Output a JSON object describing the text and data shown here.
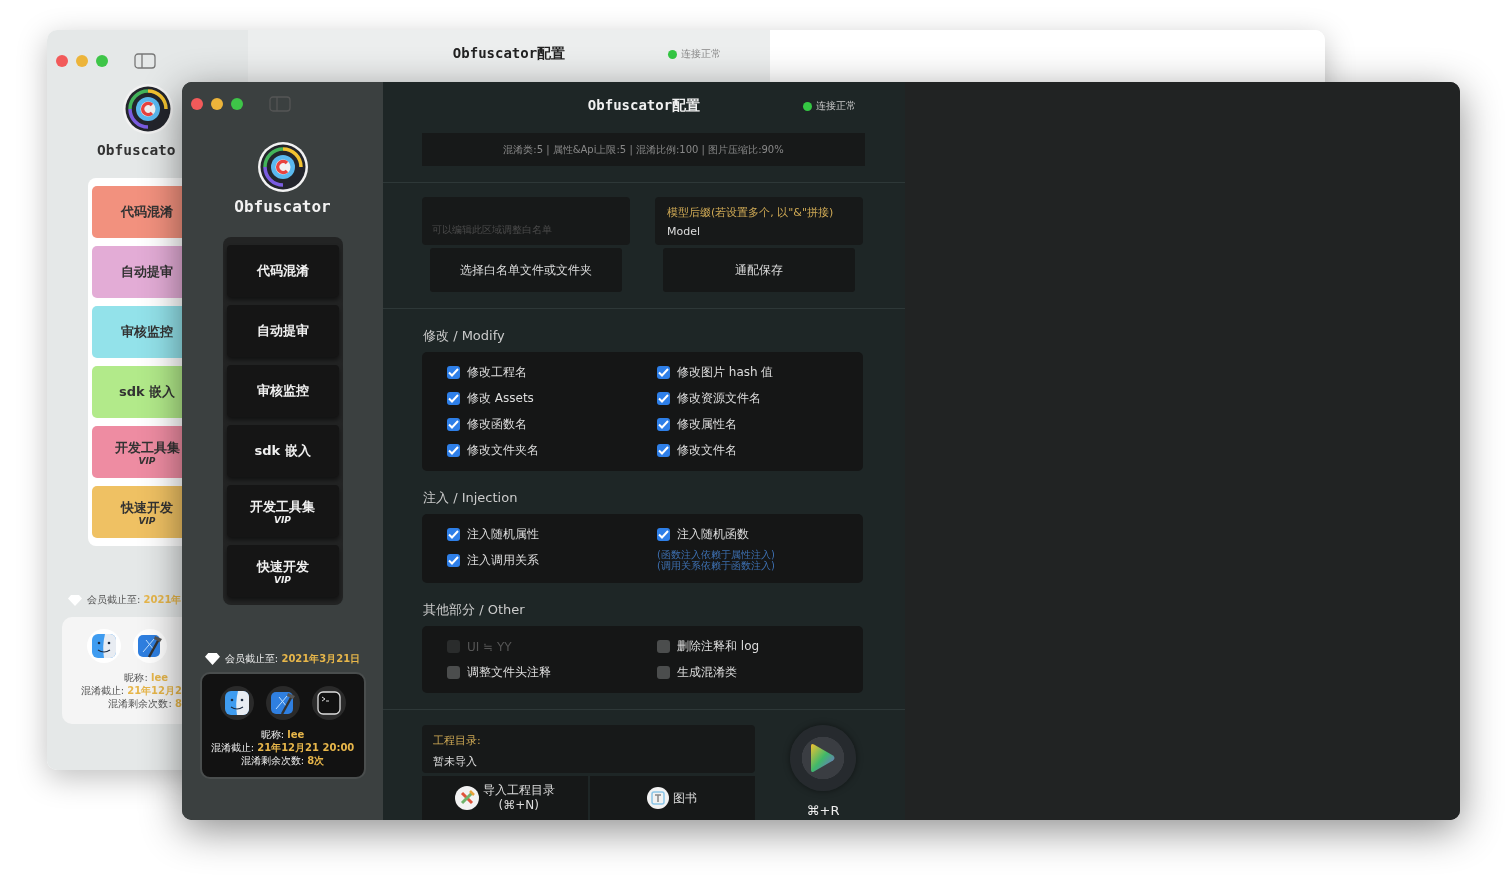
{
  "back_window": {
    "title": "Obfuscator配置",
    "status": "连接正常",
    "app_name": "Obfuscato",
    "nav_items": [
      {
        "label": "代码混淆",
        "color": "#f2917e"
      },
      {
        "label": "自动提审",
        "color": "#e3acd6"
      },
      {
        "label": "审核监控",
        "color": "#93e2ea"
      },
      {
        "label": "sdk 嵌入",
        "color": "#b2ea8a"
      },
      {
        "label": "开发工具集",
        "badge": "VIP",
        "color": "#ee8ca2"
      },
      {
        "label": "快速开发",
        "badge": "VIP",
        "color": "#efc163"
      }
    ],
    "membership": {
      "label": "会员截止至:",
      "value": "2021年"
    },
    "user": {
      "nickname_label": "昵称:",
      "nickname": "lee",
      "expiry_label": "混淆截止:",
      "expiry": "21年12月2",
      "remaining_label": "混淆剩余次数:",
      "remaining": "8"
    }
  },
  "window": {
    "title": "Obfuscator配置",
    "status": "连接正常",
    "app_name": "Obfuscator",
    "nav_items": [
      {
        "label": "代码混淆"
      },
      {
        "label": "自动提审"
      },
      {
        "label": "审核监控"
      },
      {
        "label": "sdk 嵌入"
      },
      {
        "label": "开发工具集",
        "badge": "VIP"
      },
      {
        "label": "快速开发",
        "badge": "VIP"
      }
    ],
    "membership": {
      "label": "会员截止至:",
      "value": "2021年3月21日"
    },
    "user": {
      "nickname_label": "昵称:",
      "nickname": "lee",
      "expiry_label": "混淆截止:",
      "expiry": "21年12月21 20:00",
      "remaining_label": "混淆剩余次数:",
      "remaining": "8次"
    },
    "stats": "混淆类:5 | 属性&Api上限:5 | 混淆比例:100 | 图片压缩比:90%",
    "whitelist": {
      "placeholder": "可以编辑此区域调整白名单",
      "button": "选择白名单文件或文件夹"
    },
    "model_suffix": {
      "label": "模型后缀(若设置多个, 以\"&\"拼接)",
      "value": "Model",
      "button": "通配保存"
    },
    "sections": [
      {
        "title": "修改 / Modify",
        "items": [
          {
            "label": "修改工程名",
            "checked": true,
            "disabled": false
          },
          {
            "label": "修改图片 hash 值",
            "checked": true,
            "disabled": false
          },
          {
            "label": "修改 Assets",
            "checked": true,
            "disabled": false
          },
          {
            "label": "修改资源文件名",
            "checked": true,
            "disabled": false
          },
          {
            "label": "修改函数名",
            "checked": true,
            "disabled": false
          },
          {
            "label": "修改属性名",
            "checked": true,
            "disabled": false
          },
          {
            "label": "修改文件夹名",
            "checked": true,
            "disabled": false
          },
          {
            "label": "修改文件名",
            "checked": true,
            "disabled": false
          }
        ]
      },
      {
        "title": "注入 / Injection",
        "items": [
          {
            "label": "注入随机属性",
            "checked": true,
            "disabled": false
          },
          {
            "label": "注入随机函数",
            "checked": true,
            "disabled": false
          },
          {
            "label": "注入调用关系",
            "checked": true,
            "disabled": false
          }
        ],
        "note": [
          "(函数注入依赖于属性注入)",
          "(调用关系依赖于函数注入)"
        ]
      },
      {
        "title": "其他部分 / Other",
        "items": [
          {
            "label": "UI ≒ YY",
            "checked": false,
            "disabled": true
          },
          {
            "label": "删除注释和 log",
            "checked": false,
            "disabled": false
          },
          {
            "label": "调整文件头注释",
            "checked": false,
            "disabled": false
          },
          {
            "label": "生成混淆类",
            "checked": false,
            "disabled": false
          }
        ]
      }
    ],
    "project": {
      "label": "工程目录:",
      "value": "暂未导入",
      "import_button": [
        "导入工程目录",
        "(⌘+N)"
      ],
      "book_button": "图书",
      "run_shortcut": "⌘+R"
    }
  }
}
